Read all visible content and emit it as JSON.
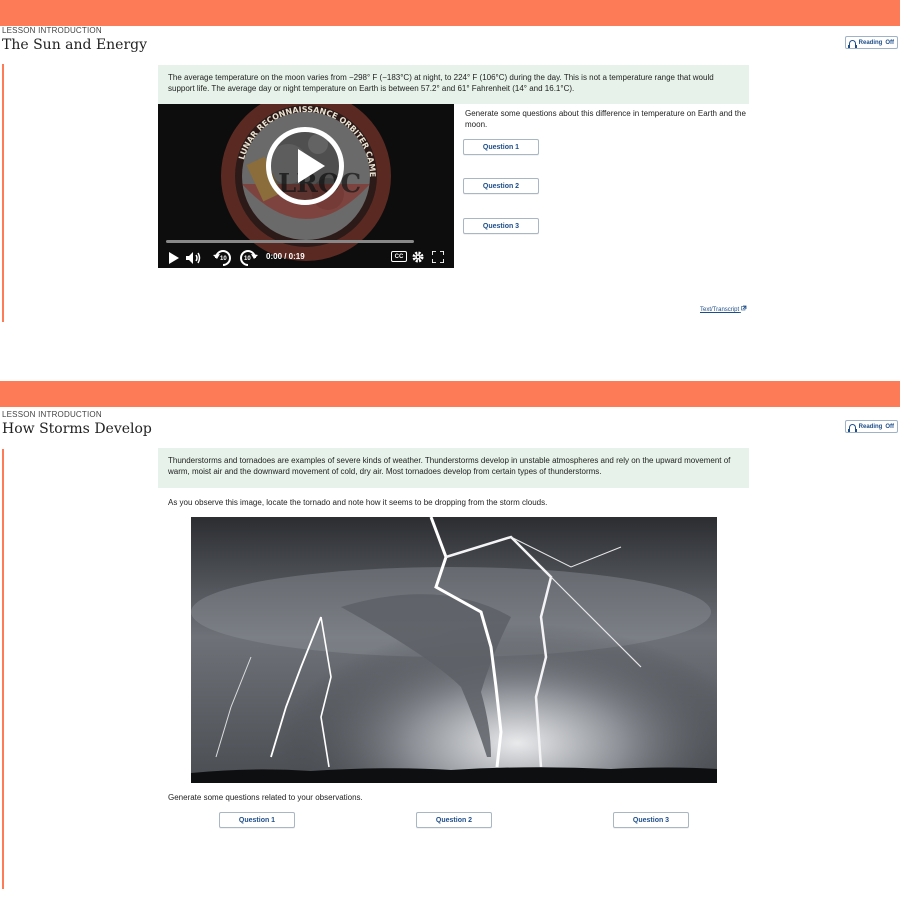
{
  "lessons": [
    {
      "eyebrow": "LESSON INTRODUCTION",
      "title": "The Sun and Energy",
      "reading": {
        "label": "Reading",
        "state": "Off"
      },
      "intro": "The average temperature on the moon varies from −298° F (−183°C) at night, to 224° F (106°C) during the day. This is not a temperature range that would support life. The average day or night temperature on Earth is between 57.2° and 61° Fahrenheit (14° and 16.1°C).",
      "prompt": "Generate some questions about this difference in temperature on Earth and the moon.",
      "questions": [
        "Question 1",
        "Question 2",
        "Question 3"
      ],
      "video": {
        "time": "0:00 / 0:19",
        "cc_label": "CC",
        "skip_back": "10",
        "skip_forward": "10",
        "logo_text": "LROC",
        "ring_text": "LUNAR RECONNAISSANCE ORBITER CAMERA",
        "progress": 0
      },
      "transcript_label": "Text/Transcript"
    },
    {
      "eyebrow": "LESSON INTRODUCTION",
      "title": "How Storms Develop",
      "reading": {
        "label": "Reading",
        "state": "Off"
      },
      "intro": "Thunderstorms and tornadoes are examples of severe kinds of weather. Thunderstorms develop in unstable atmospheres and rely on the upward movement of warm, moist air and the downward movement of cold, dry air. Most tornadoes develop from certain types of thunderstorms.",
      "observe_text": "As you observe this image, locate the tornado and note how it seems to be dropping from the storm clouds.",
      "prompt": "Generate some questions related to your observations.",
      "questions": [
        "Question 1",
        "Question 2",
        "Question 3"
      ]
    }
  ],
  "colors": {
    "accent": "#fe7b57",
    "intro_bg": "#e7f3ea",
    "link": "#1d4e89"
  },
  "icons": [
    "headphones-icon",
    "play-icon",
    "volume-icon",
    "rewind-10-icon",
    "forward-10-icon",
    "settings-gear-icon",
    "fullscreen-icon",
    "external-link-icon"
  ]
}
